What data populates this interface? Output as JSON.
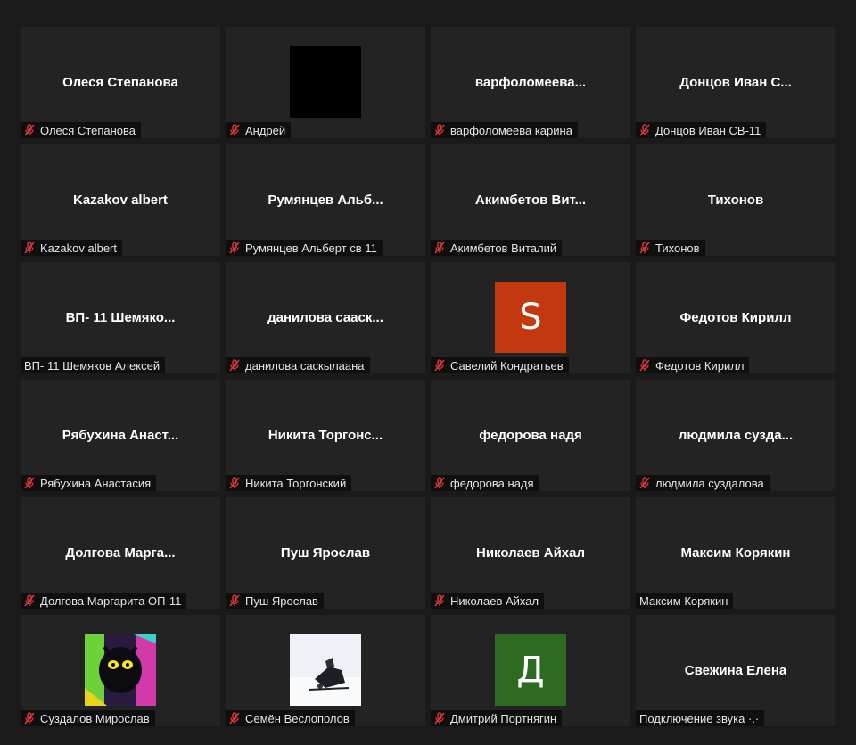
{
  "participants": [
    {
      "tile": "Олеся Степанова",
      "label": "Олеся Степанова",
      "muted": true
    },
    {
      "tile": "",
      "label": "Андрей",
      "muted": true,
      "video": "black"
    },
    {
      "tile": "варфоломеева...",
      "label": "варфоломеева карина",
      "muted": true
    },
    {
      "tile": "Донцов Иван С...",
      "label": "Донцов Иван СВ-11",
      "muted": true
    },
    {
      "tile": "Kazakov albert",
      "label": "Kazakov albert",
      "muted": true
    },
    {
      "tile": "Румянцев Альб...",
      "label": "Румянцев Альберт св 11",
      "muted": true
    },
    {
      "tile": "Акимбетов Вит...",
      "label": "Акимбетов Виталий",
      "muted": true
    },
    {
      "tile": "Тихонов",
      "label": "Тихонов",
      "muted": true
    },
    {
      "tile": "ВП- 11 Шемяко...",
      "label": "ВП- 11 Шемяков Алексей",
      "muted": false
    },
    {
      "tile": "данилова сааск...",
      "label": "данилова саскылаана",
      "muted": true
    },
    {
      "tile": "",
      "label": "Савелий Кондратьев",
      "muted": true,
      "avatar_letter": "S",
      "avatar_color": "#c4380f"
    },
    {
      "tile": "Федотов Кирилл",
      "label": "Федотов Кирилл",
      "muted": true
    },
    {
      "tile": "Рябухина Анаст...",
      "label": "Рябухина Анастасия",
      "muted": true
    },
    {
      "tile": "Никита Торгонс...",
      "label": "Никита Торгонский",
      "muted": true
    },
    {
      "tile": "федорова надя",
      "label": "федорова надя",
      "muted": true
    },
    {
      "tile": "людмила сузда...",
      "label": "людмила суздалова",
      "muted": true
    },
    {
      "tile": "Долгова Марга...",
      "label": "Долгова Маргарита ОП-11",
      "muted": true
    },
    {
      "tile": "Пуш Ярослав",
      "label": "Пуш Ярослав",
      "muted": true
    },
    {
      "tile": "Николаев Айхал",
      "label": "Николаев Айхал",
      "muted": true
    },
    {
      "tile": "Максим Корякин",
      "label": "Максим Корякин",
      "muted": false
    },
    {
      "tile": "",
      "label": "Суздалов Мирослав",
      "muted": true,
      "video": "art"
    },
    {
      "tile": "",
      "label": "Семён Веслополов",
      "muted": true,
      "video": "photo"
    },
    {
      "tile": "",
      "label": "Дмитрий Портнягин",
      "muted": true,
      "avatar_letter": "Д",
      "avatar_color": "#2c6b20"
    },
    {
      "tile": "Свежина Елена",
      "label": "Подключение звука ·.·",
      "muted": false
    }
  ],
  "colors": {
    "background": "#1a1a1a",
    "tile": "#232323",
    "muted_icon": "#e0383b"
  }
}
